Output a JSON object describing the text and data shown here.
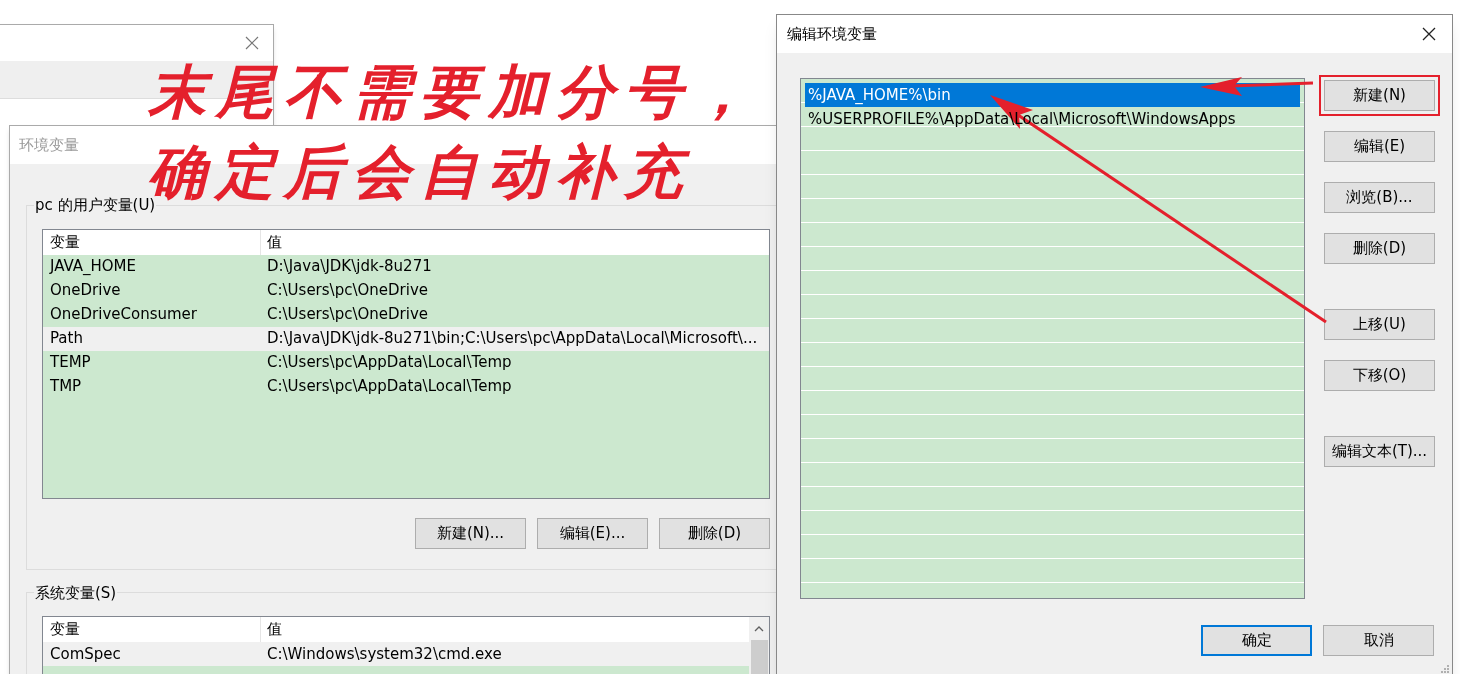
{
  "env_window": {
    "title": "环境变量",
    "user_group": {
      "title": "pc 的用户变量(U)",
      "columns": [
        "变量",
        "值"
      ],
      "rows": [
        {
          "name": "JAVA_HOME",
          "value": "D:\\Java\\JDK\\jdk-8u271",
          "selected": false
        },
        {
          "name": "OneDrive",
          "value": "C:\\Users\\pc\\OneDrive",
          "selected": false
        },
        {
          "name": "OneDriveConsumer",
          "value": "C:\\Users\\pc\\OneDrive",
          "selected": false
        },
        {
          "name": "Path",
          "value": "D:\\Java\\JDK\\jdk-8u271\\bin;C:\\Users\\pc\\AppData\\Local\\Microsoft\\...",
          "selected": true
        },
        {
          "name": "TEMP",
          "value": "C:\\Users\\pc\\AppData\\Local\\Temp",
          "selected": false
        },
        {
          "name": "TMP",
          "value": "C:\\Users\\pc\\AppData\\Local\\Temp",
          "selected": false
        }
      ],
      "buttons": [
        "新建(N)...",
        "编辑(E)...",
        "删除(D)"
      ]
    },
    "system_group": {
      "title": "系统变量(S)",
      "columns": [
        "变量",
        "值"
      ],
      "rows": [
        {
          "name": "ComSpec",
          "value": "C:\\Windows\\system32\\cmd.exe",
          "selected": true
        }
      ]
    }
  },
  "edit_dialog": {
    "title": "编辑环境变量",
    "entries": [
      {
        "text": "%JAVA_HOME%\\bin",
        "selected": true
      },
      {
        "text": "%USERPROFILE%\\AppData\\Local\\Microsoft\\WindowsApps",
        "selected": false
      }
    ],
    "side_buttons": [
      {
        "label": "新建(N)",
        "circled": true
      },
      {
        "label": "编辑(E)",
        "circled": false
      },
      {
        "label": "浏览(B)...",
        "circled": false
      },
      {
        "label": "删除(D)",
        "circled": false
      },
      {
        "label": "上移(U)",
        "circled": false
      },
      {
        "label": "下移(O)",
        "circled": false
      },
      {
        "label": "编辑文本(T)...",
        "circled": false
      }
    ],
    "bottom_buttons": [
      {
        "label": "确定",
        "kind": "default"
      },
      {
        "label": "取消",
        "kind": "normal"
      }
    ]
  },
  "annotation": {
    "lines": [
      "末尾不需要加分号，",
      "确定后会自动补充"
    ]
  }
}
